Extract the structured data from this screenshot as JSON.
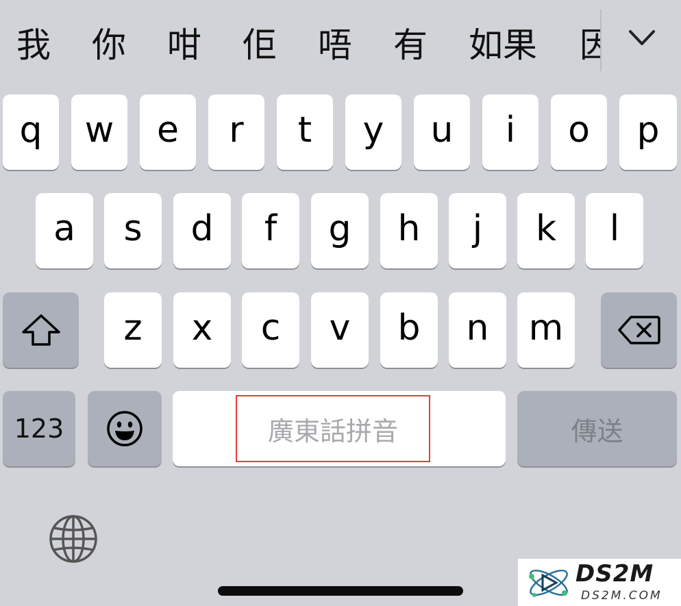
{
  "candidates": [
    "我",
    "你",
    "咁",
    "佢",
    "唔",
    "有",
    "如果",
    "因"
  ],
  "rows": {
    "row1": [
      "q",
      "w",
      "e",
      "r",
      "t",
      "y",
      "u",
      "i",
      "o",
      "p"
    ],
    "row2": [
      "a",
      "s",
      "d",
      "f",
      "g",
      "h",
      "j",
      "k",
      "l"
    ],
    "row3": [
      "z",
      "x",
      "c",
      "v",
      "b",
      "n",
      "m"
    ]
  },
  "bottom_row": {
    "numbers_label": "123",
    "space_label": "廣東話拼音",
    "send_label": "傳送"
  },
  "icons": {
    "collapse": "chevron-down-icon",
    "shift": "shift-icon",
    "backspace": "backspace-icon",
    "emoji": "emoji-icon",
    "globe": "globe-icon"
  },
  "watermark": {
    "title": "DS2M",
    "subtitle": "DS2M.COM"
  },
  "colors": {
    "keyboard_bg": "#d1d3d9",
    "key": "#ffffff",
    "key_dark": "#abb0ba",
    "highlight": "#e03e3e"
  }
}
